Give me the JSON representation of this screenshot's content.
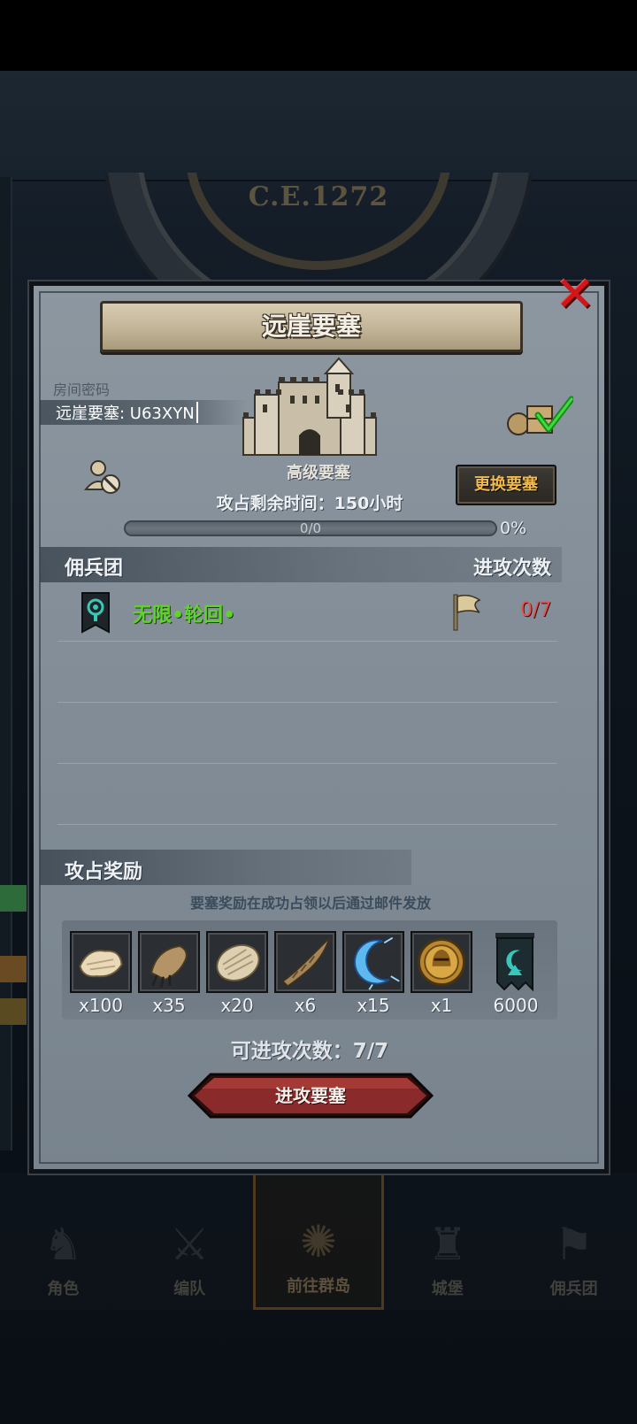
{
  "background": {
    "year": "C.E.1272",
    "bottom_nav": [
      {
        "label": "角色",
        "icon": "character-icon"
      },
      {
        "label": "编队",
        "icon": "formation-icon"
      },
      {
        "label": "前往群岛",
        "icon": "islands-icon",
        "active": true
      },
      {
        "label": "城堡",
        "icon": "castle-icon"
      },
      {
        "label": "佣兵团",
        "icon": "mercenary-icon"
      }
    ]
  },
  "modal": {
    "title": "远崖要塞",
    "room": {
      "label": "房间密码",
      "value": "远崖要塞: U63XYN"
    },
    "fortress_grade": "高级要塞",
    "change_button": "更换要塞",
    "occupy_time": "攻占剩余时间：150小时",
    "progress": {
      "text": "0/0",
      "percent_text": "0%",
      "fraction": 0
    },
    "mercenary_header": "佣兵团",
    "attack_count_header": "进攻次数",
    "mercenaries": [
      {
        "name": "无限•轮回•",
        "attacks": "0/7"
      }
    ],
    "rewards_header": "攻占奖励",
    "reward_note": "要塞奖励在成功占领以后通过邮件发放",
    "rewards": [
      {
        "item": "hide-icon",
        "qty": "x100"
      },
      {
        "item": "claw-icon",
        "qty": "x35"
      },
      {
        "item": "fur-icon",
        "qty": "x20"
      },
      {
        "item": "horn-icon",
        "qty": "x6"
      },
      {
        "item": "crescent-rune-icon",
        "qty": "x15"
      },
      {
        "item": "helmet-medal-icon",
        "qty": "x1"
      },
      {
        "item": "guild-banner-icon",
        "qty": "6000"
      }
    ],
    "attack_times": "可进攻次数：7/7",
    "attack_button": "进攻要塞"
  },
  "colors": {
    "accent_orange": "#f2b94c",
    "merc_green": "#5fd32d",
    "count_red": "#e85252",
    "close_red": "#d0161a"
  }
}
